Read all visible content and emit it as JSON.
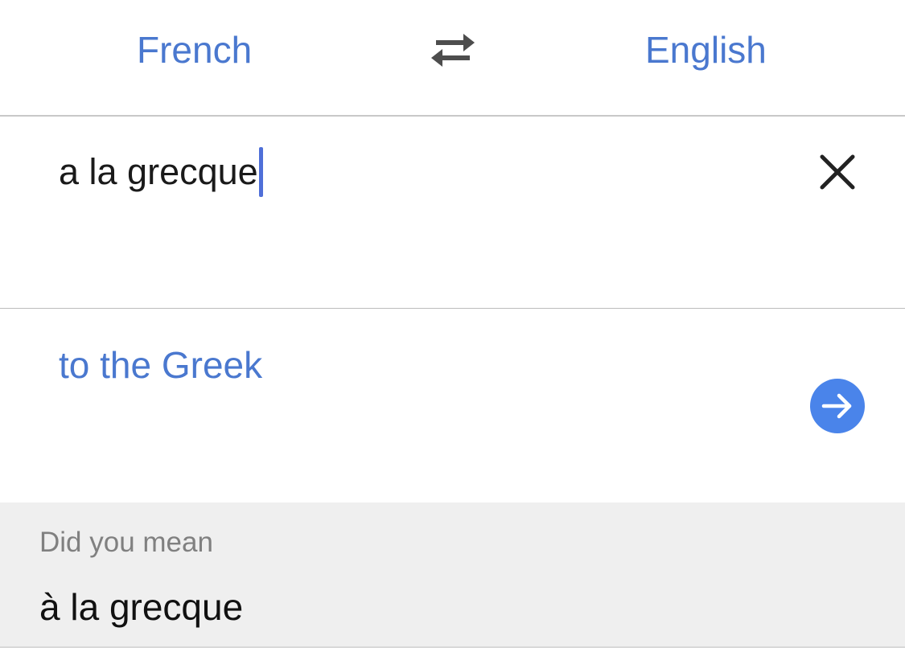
{
  "language_bar": {
    "source_language": "French",
    "target_language": "English",
    "swap_icon": "swap-horizontal-arrows-icon"
  },
  "input": {
    "text": "a la grecque",
    "clear_icon": "close-icon"
  },
  "translation": {
    "text": "to the Greek",
    "go_icon": "arrow-right-icon"
  },
  "suggestion": {
    "label": "Did you mean",
    "text": "à la grecque"
  },
  "colors": {
    "accent": "#4a78cf",
    "go_button": "#4a84ea",
    "caret": "#4f6fd8",
    "suggestion_background": "#efefef"
  }
}
